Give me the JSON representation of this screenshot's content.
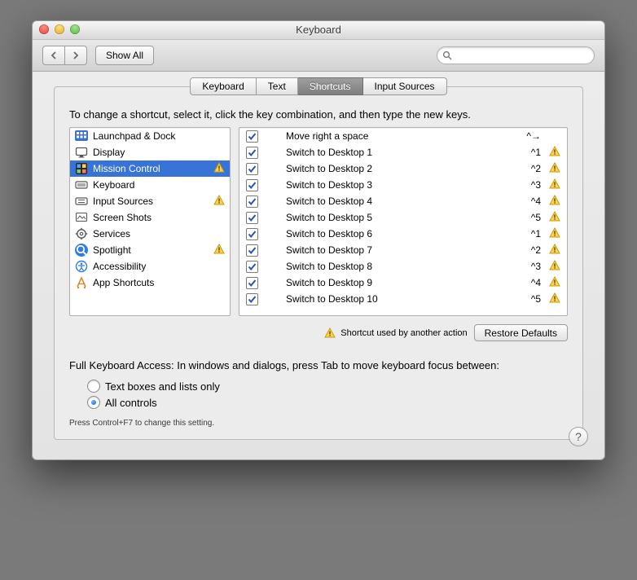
{
  "window": {
    "title": "Keyboard"
  },
  "toolbar": {
    "show_all": "Show All",
    "search_placeholder": ""
  },
  "tabs": [
    "Keyboard",
    "Text",
    "Shortcuts",
    "Input Sources"
  ],
  "active_tab": 2,
  "instruction": "To change a shortcut, select it, click the key combination, and then type the new keys.",
  "categories": [
    {
      "label": "Launchpad & Dock",
      "icon": "launchpad",
      "warn": false,
      "selected": false
    },
    {
      "label": "Display",
      "icon": "display",
      "warn": false,
      "selected": false
    },
    {
      "label": "Mission Control",
      "icon": "mission",
      "warn": true,
      "selected": true
    },
    {
      "label": "Keyboard",
      "icon": "keyboard",
      "warn": false,
      "selected": false
    },
    {
      "label": "Input Sources",
      "icon": "inputsrc",
      "warn": true,
      "selected": false
    },
    {
      "label": "Screen Shots",
      "icon": "screenshots",
      "warn": false,
      "selected": false
    },
    {
      "label": "Services",
      "icon": "services",
      "warn": false,
      "selected": false
    },
    {
      "label": "Spotlight",
      "icon": "spotlight",
      "warn": true,
      "selected": false
    },
    {
      "label": "Accessibility",
      "icon": "accessibility",
      "warn": false,
      "selected": false
    },
    {
      "label": "App Shortcuts",
      "icon": "appshortcuts",
      "warn": false,
      "selected": false
    }
  ],
  "shortcuts": [
    {
      "checked": true,
      "label": "Move right a space",
      "key": "^→",
      "warn": false
    },
    {
      "checked": true,
      "label": "Switch to Desktop 1",
      "key": "^1",
      "warn": true
    },
    {
      "checked": true,
      "label": "Switch to Desktop 2",
      "key": "^2",
      "warn": true
    },
    {
      "checked": true,
      "label": "Switch to Desktop 3",
      "key": "^3",
      "warn": true
    },
    {
      "checked": true,
      "label": "Switch to Desktop 4",
      "key": "^4",
      "warn": true
    },
    {
      "checked": true,
      "label": "Switch to Desktop 5",
      "key": "^5",
      "warn": true
    },
    {
      "checked": true,
      "label": "Switch to Desktop 6",
      "key": "^1",
      "warn": true
    },
    {
      "checked": true,
      "label": "Switch to Desktop 7",
      "key": "^2",
      "warn": true
    },
    {
      "checked": true,
      "label": "Switch to Desktop 8",
      "key": "^3",
      "warn": true
    },
    {
      "checked": true,
      "label": "Switch to Desktop 9",
      "key": "^4",
      "warn": true
    },
    {
      "checked": true,
      "label": "Switch to Desktop 10",
      "key": "^5",
      "warn": true
    }
  ],
  "conflict_note": "Shortcut used by another action",
  "restore_defaults": "Restore Defaults",
  "fka": {
    "heading": "Full Keyboard Access: In windows and dialogs, press Tab to move keyboard focus between:",
    "options": [
      "Text boxes and lists only",
      "All controls"
    ],
    "selected": 1,
    "hint": "Press Control+F7 to change this setting."
  }
}
